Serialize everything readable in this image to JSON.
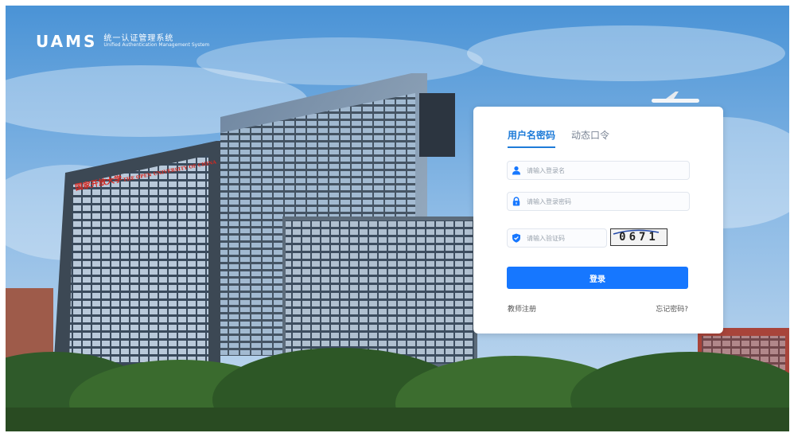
{
  "brand": {
    "logo_text": "UAMS",
    "title_cn": "统一认证管理系统",
    "title_en": "Unified Authentication Management System"
  },
  "background": {
    "sign_cn": "国家开放大学",
    "sign_en": "THE OPEN UNIVERSITY OF CHINA"
  },
  "login": {
    "tabs": [
      {
        "label": "用户名密码",
        "active": true
      },
      {
        "label": "动态口令",
        "active": false
      }
    ],
    "username": {
      "placeholder": "请输入登录名",
      "value": ""
    },
    "password": {
      "placeholder": "请输入登录密码",
      "value": ""
    },
    "captcha": {
      "placeholder": "请输入验证码",
      "value": "",
      "image_text": "0671"
    },
    "submit_label": "登录",
    "register_link": "教师注册",
    "forgot_link": "忘记密码?"
  },
  "colors": {
    "accent": "#1677ff",
    "tab_active": "#1e7bd8"
  },
  "icons": {
    "username": "user-icon",
    "password": "lock-icon",
    "captcha": "shield-icon"
  }
}
